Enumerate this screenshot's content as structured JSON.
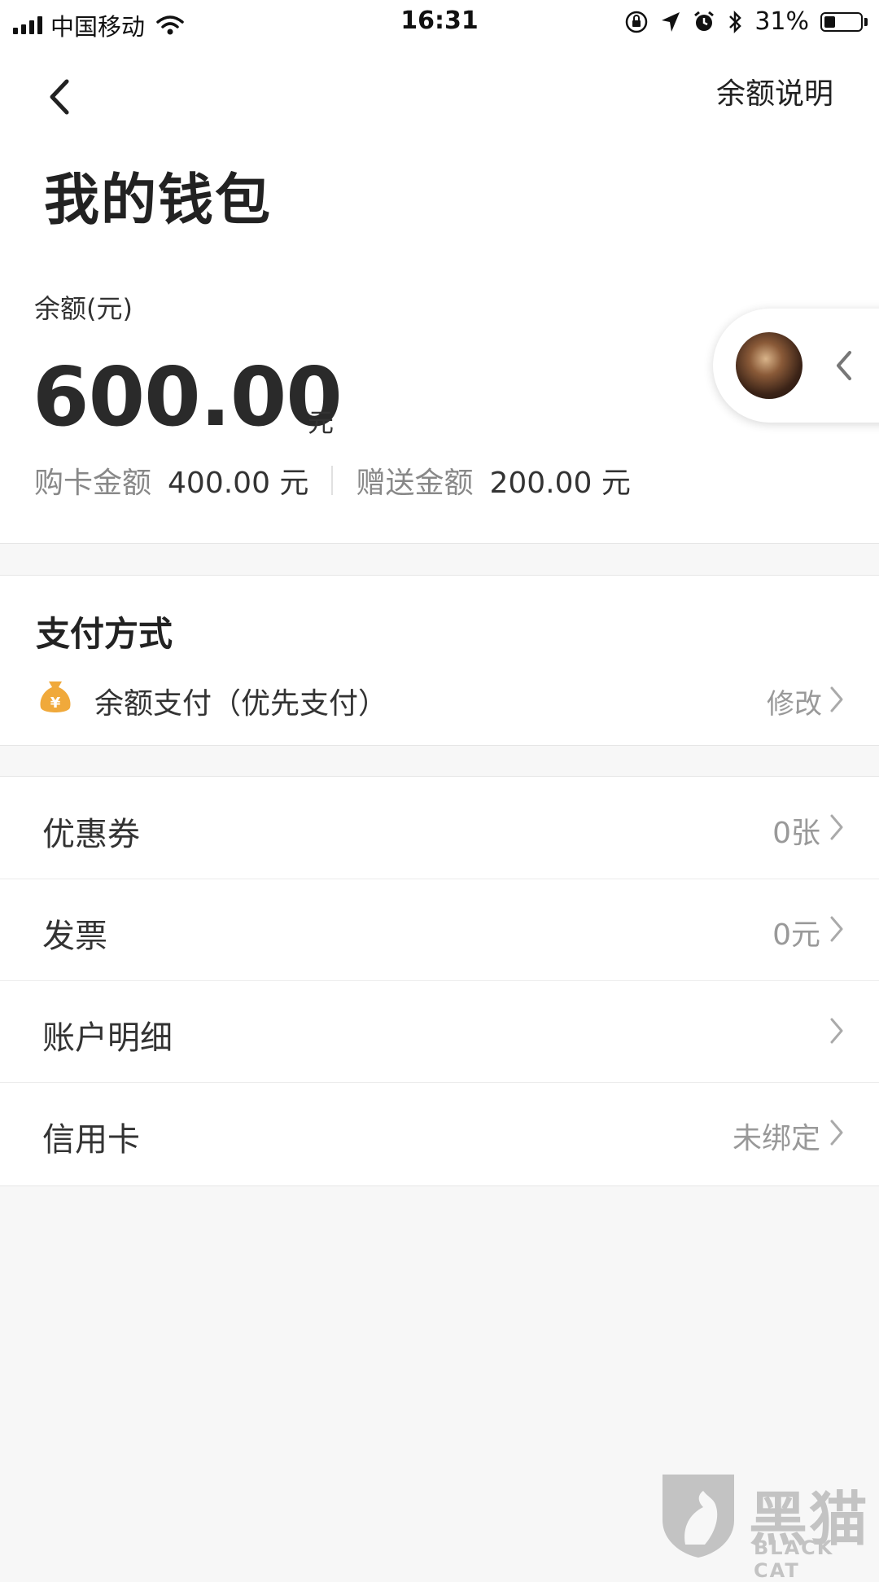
{
  "status_bar": {
    "carrier": "中国移动",
    "time": "16:31",
    "battery_percent": "31%",
    "battery_level": 0.31
  },
  "nav": {
    "back_icon": "chevron-left-icon",
    "help_label": "余额说明"
  },
  "page": {
    "title": "我的钱包"
  },
  "balance": {
    "label": "余额(元)",
    "amount": "600.00",
    "unit": "元",
    "purchased_label": "购卡金额",
    "purchased_value": "400.00 元",
    "bonus_label": "赠送金额",
    "bonus_value": "200.00 元"
  },
  "payment": {
    "title": "支付方式",
    "icon": "money-bag-icon",
    "method": "余额支付（优先支付）",
    "edit_label": "修改"
  },
  "list": [
    {
      "label": "优惠券",
      "value": "0张"
    },
    {
      "label": "发票",
      "value": "0元"
    },
    {
      "label": "账户明细",
      "value": ""
    },
    {
      "label": "信用卡",
      "value": "未绑定"
    }
  ],
  "watermark": {
    "brand_cn": "黑猫",
    "brand_en": "BLACK CAT"
  },
  "colors": {
    "accent_gold": "#f0a93b",
    "background": "#f7f7f7",
    "muted_text": "#999999"
  }
}
